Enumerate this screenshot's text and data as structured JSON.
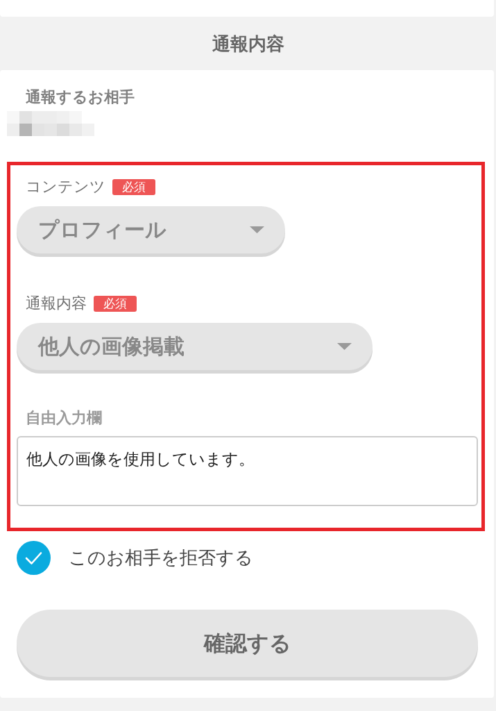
{
  "header": {
    "title": "通報内容"
  },
  "target": {
    "label": "通報するお相手"
  },
  "form": {
    "highlighted": true,
    "fields": [
      {
        "kind": "select",
        "label": "コンテンツ",
        "badge": "必須",
        "value": "プロフィール"
      },
      {
        "kind": "select",
        "label": "通報内容",
        "badge": "必須",
        "value": "他人の画像掲載"
      },
      {
        "kind": "textarea",
        "label": "自由入力欄",
        "value": "他人の画像を使用しています。"
      }
    ]
  },
  "block_option": {
    "label": "このお相手を拒否する",
    "checked": true
  },
  "confirm_button": {
    "label": "確認する"
  }
}
